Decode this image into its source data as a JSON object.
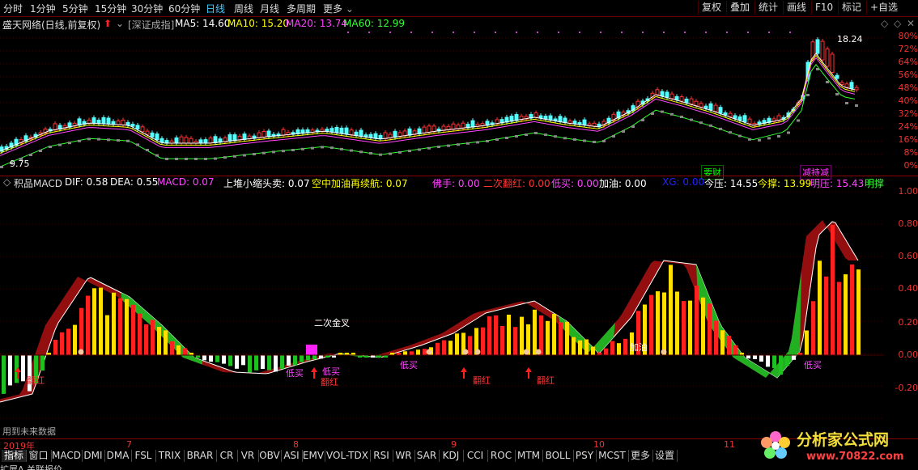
{
  "toolbar": {
    "periods": [
      "分时",
      "1分钟",
      "5分钟",
      "15分钟",
      "30分钟",
      "60分钟",
      "日线",
      "周线",
      "月线",
      "多周期",
      "更多"
    ],
    "active_period": "日线",
    "right_buttons": [
      "复权",
      "叠加",
      "统计",
      "画线",
      "F10",
      "标记",
      "+自选"
    ]
  },
  "info": {
    "title": "盛天网络(日线,前复权)",
    "index_label": "[深证成指]",
    "ma5": "MA5: 14.60",
    "ma10": "MA10: 15.20",
    "ma20": "MA20: 13.74",
    "ma60": "MA60: 12.99"
  },
  "main_chart": {
    "low_label": "9.75",
    "high_label": "18.24",
    "ylabels": [
      "80%",
      "72%",
      "64%",
      "56%",
      "48%",
      "40%",
      "32%",
      "24%",
      "16%",
      "8%",
      "0%"
    ],
    "tag1": "要财",
    "tag2": "减持减"
  },
  "indicator": {
    "name": "积品MACD",
    "dif": "DIF: 0.58",
    "dea": "DEA: 0.55",
    "macd": "MACD: 0.07",
    "s1": "上堆小缩头卖: 0.07",
    "s2": "空中加油再续航: 0.07",
    "s3": "佛手: 0.00",
    "s4": "二次翻红: 0.00",
    "s5": "低买: 0.00",
    "s6": "加油: 0.00",
    "s7": "XG: 0.00",
    "s8": "今压: 14.55",
    "s9": "今撑: 13.99",
    "s10": "明压: 15.43",
    "s11": "明撑"
  },
  "sub_chart": {
    "ylabels": [
      "1.00",
      "0.80",
      "0.60",
      "0.40",
      "0.20",
      "0.00",
      "-0.20"
    ],
    "annotations": {
      "erci_jincha": "二次金叉",
      "fanhong": "翻红",
      "dimai": "低买",
      "jiayou": "加油"
    },
    "future_note": "用到未来数据"
  },
  "dates": [
    "2019年",
    "7",
    "8",
    "9",
    "10",
    "11"
  ],
  "tabs": [
    "指标",
    "窗口",
    "MACD",
    "DMI",
    "DMA",
    "FSL",
    "TRIX",
    "BRAR",
    "CR",
    "VR",
    "OBV",
    "ASI",
    "EMV",
    "VOL-TDX",
    "RSI",
    "WR",
    "SAR",
    "KDJ",
    "CCI",
    "ROC",
    "MTM",
    "BOLL",
    "PSY",
    "MCST",
    "更多",
    "设置"
  ],
  "active_tab": "指标",
  "bottom_text": "扩展A  关联报价",
  "logo": {
    "text": "分析家公式网",
    "url_text": "www.70822.com"
  },
  "colors": {
    "up": "#ff3232",
    "down": "#54ffff",
    "macd_pos": "#ff2020",
    "macd_neg": "#20c020",
    "accent": "#4cf"
  }
}
